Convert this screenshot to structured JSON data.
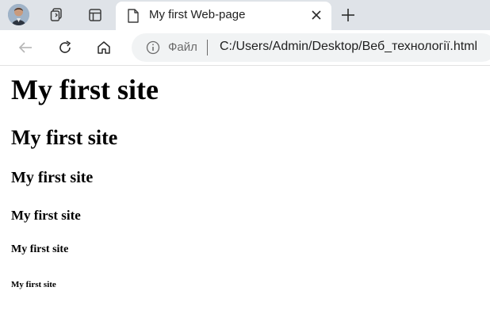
{
  "browser": {
    "tab": {
      "title": "My first Web-page"
    },
    "address_bar": {
      "scheme_label": "Файл",
      "url": "C:/Users/Admin/Desktop/Веб_технології.html"
    }
  },
  "page": {
    "headings": [
      "My first site",
      "My first site",
      "My first site",
      "My first site",
      "My first site",
      "My first site"
    ]
  }
}
